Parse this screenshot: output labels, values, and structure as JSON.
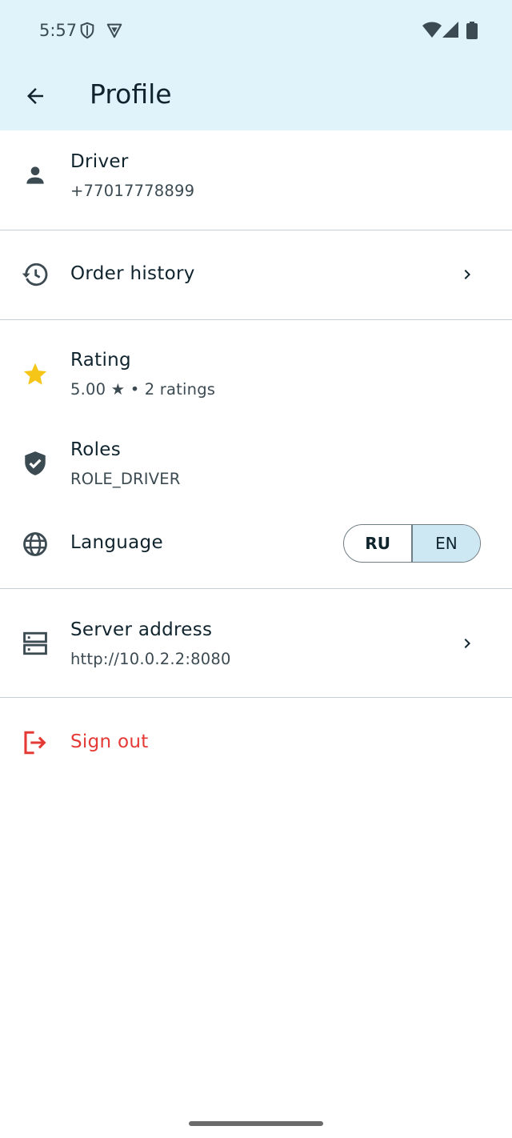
{
  "status_bar": {
    "time": "5:57"
  },
  "app_bar": {
    "title": "Profile"
  },
  "user": {
    "name": "Driver",
    "phone": "+77017778899"
  },
  "order_history": {
    "label": "Order history"
  },
  "rating": {
    "label": "Rating",
    "value": "5.00 ★ • 2 ratings"
  },
  "roles": {
    "label": "Roles",
    "value": "ROLE_DRIVER"
  },
  "language": {
    "label": "Language",
    "options": [
      "RU",
      "EN"
    ],
    "selected": "EN"
  },
  "server": {
    "label": "Server address",
    "value": "http://10.0.2.2:8080"
  },
  "sign_out": {
    "label": "Sign out"
  },
  "colors": {
    "header_bg": "#e0f3fa",
    "star": "#f5c518",
    "sign_out": "#e53935",
    "selected_segment": "#cde8f2"
  }
}
